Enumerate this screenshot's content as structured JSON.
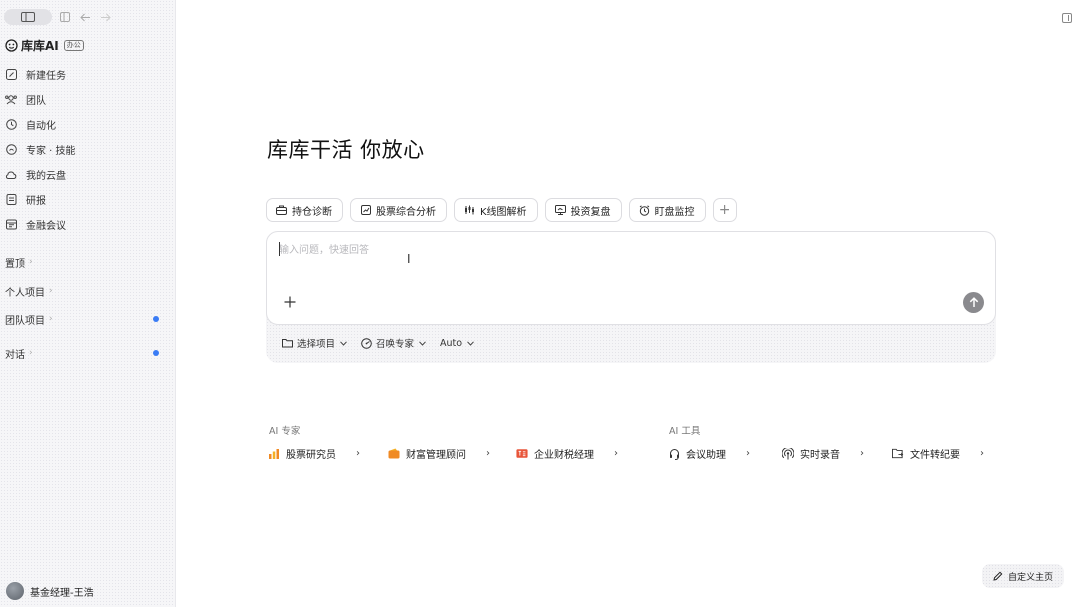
{
  "app": {
    "brand_name": "库库AI",
    "brand_badge": "办公",
    "accent_color": "#3a7cf5"
  },
  "sidebar": {
    "nav": [
      {
        "label": "新建任务",
        "icon": "edit-icon"
      },
      {
        "label": "团队",
        "icon": "team-icon"
      },
      {
        "label": "自动化",
        "icon": "automation-icon"
      },
      {
        "label": "专家 · 技能",
        "icon": "expert-icon"
      },
      {
        "label": "我的云盘",
        "icon": "cloud-icon"
      },
      {
        "label": "研报",
        "icon": "report-icon"
      },
      {
        "label": "金融会议",
        "icon": "meeting-icon"
      }
    ],
    "sections": [
      {
        "label": "置顶",
        "dot": false
      },
      {
        "label": "个人项目",
        "dot": false
      },
      {
        "label": "团队项目",
        "dot": true
      },
      {
        "label": "对话",
        "dot": true
      }
    ],
    "user_name": "基金经理-王浩"
  },
  "main": {
    "headline": "库库干活 你放心",
    "chips": [
      {
        "label": "持仓诊断",
        "icon": "briefcase-icon"
      },
      {
        "label": "股票综合分析",
        "icon": "stock-analysis-icon"
      },
      {
        "label": "K线图解析",
        "icon": "kline-icon"
      },
      {
        "label": "投资复盘",
        "icon": "review-icon"
      },
      {
        "label": "盯盘监控",
        "icon": "alarm-icon"
      }
    ],
    "input_placeholder": "输入问题，快速回答",
    "options": [
      {
        "label": "选择项目",
        "icon": "folder-icon"
      },
      {
        "label": "召唤专家",
        "icon": "expert-summon-icon"
      },
      {
        "label": "Auto",
        "icon": ""
      }
    ],
    "ai_experts_title": "AI 专家",
    "ai_experts": [
      {
        "label": "股票研究员",
        "icon": "bar-chart-icon",
        "color": "#f08a24"
      },
      {
        "label": "财富管理顾问",
        "icon": "wallet-icon",
        "color": "#f08a24"
      },
      {
        "label": "企业财税经理",
        "icon": "tax-icon",
        "color": "#e8553a"
      }
    ],
    "ai_tools_title": "AI 工具",
    "ai_tools": [
      {
        "label": "会议助理",
        "icon": "headset-icon"
      },
      {
        "label": "实时录音",
        "icon": "broadcast-icon"
      },
      {
        "label": "文件转纪要",
        "icon": "file-convert-icon"
      }
    ],
    "custom_home": "自定义主页"
  }
}
